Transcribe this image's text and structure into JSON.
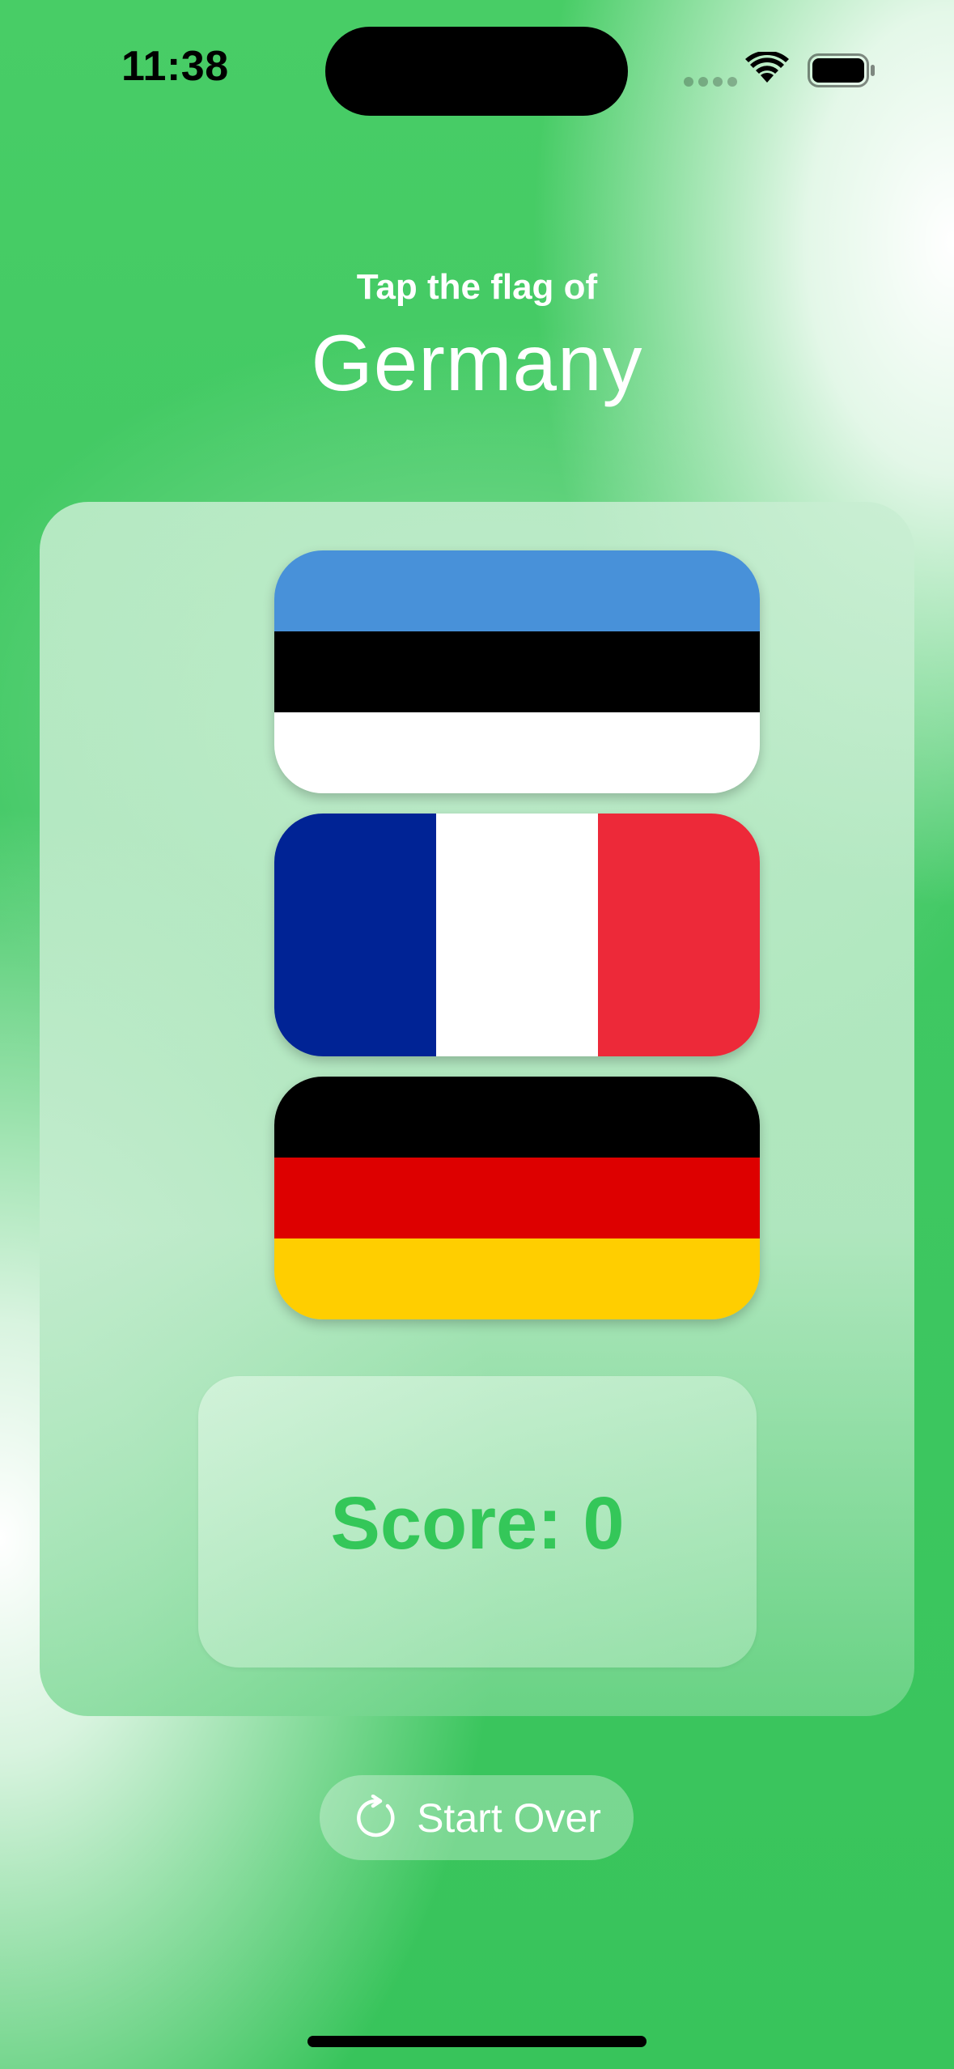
{
  "status_bar": {
    "time": "11:38",
    "icons": [
      "cellular-signal-icon",
      "wifi-icon",
      "battery-icon"
    ]
  },
  "header": {
    "prompt": "Tap the flag of",
    "country": "Germany"
  },
  "flags": [
    {
      "name": "Estonia",
      "orientation": "horizontal",
      "stripes": [
        "#4891d9",
        "#000000",
        "#ffffff"
      ]
    },
    {
      "name": "France",
      "orientation": "vertical",
      "stripes": [
        "#002395",
        "#ffffff",
        "#ed2939"
      ]
    },
    {
      "name": "Germany",
      "orientation": "horizontal",
      "stripes": [
        "#000000",
        "#dd0000",
        "#ffce00"
      ]
    }
  ],
  "score": {
    "label": "Score: 0"
  },
  "start_over": {
    "icon": "restart-icon",
    "label": "Start Over"
  },
  "colors": {
    "accent_green": "#34c759",
    "background_green": "#3cc65e"
  }
}
